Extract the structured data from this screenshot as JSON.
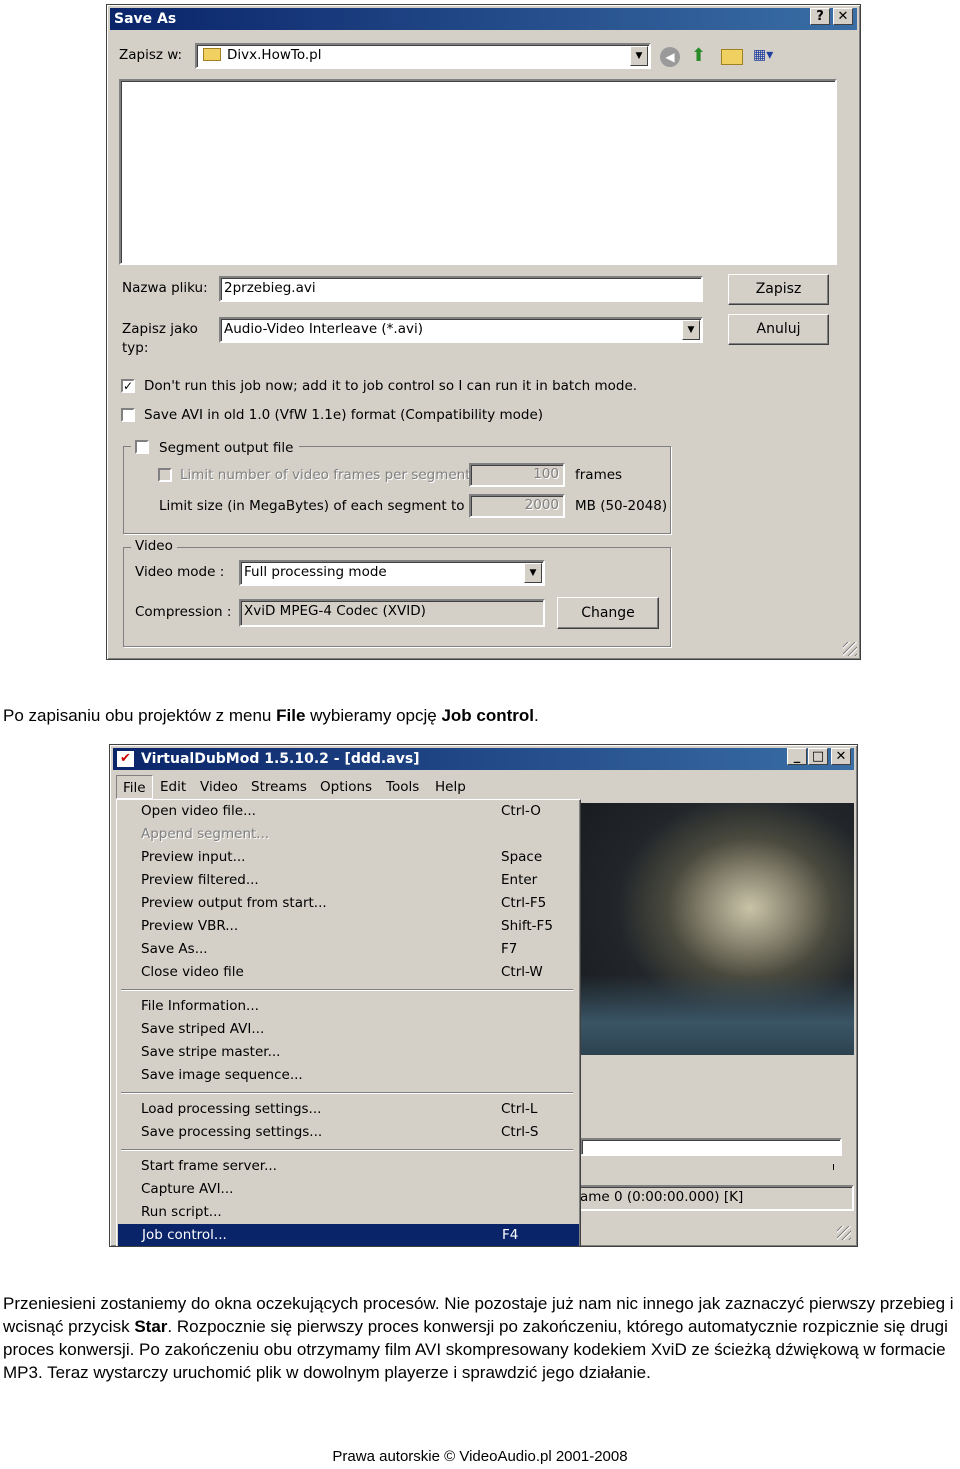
{
  "save_dialog": {
    "title": "Save As",
    "help_btn": "?",
    "close_btn": "✕",
    "location_label": "Zapisz w:",
    "location_value": "Divx.HowTo.pl",
    "filename_label": "Nazwa pliku:",
    "filename_value": "2przebieg.avi",
    "filetype_label": "Zapisz jako typ:",
    "filetype_value": "Audio-Video Interleave (*.avi)",
    "save_button": "Zapisz",
    "cancel_button": "Anuluj",
    "option_job_control": "Don't run this job now; add it to job control so I can run it in batch mode.",
    "option_old_avi": "Save AVI in old 1.0 (VfW 1.1e) format (Compatibility mode)",
    "segment_group": "Segment output file",
    "limit_frames_label": "Limit number of video frames per segment to",
    "limit_frames_value": "100",
    "frames_unit": "frames",
    "limit_size_label": "Limit size (in MegaBytes) of each segment to :",
    "limit_size_value": "2000",
    "size_unit": "MB (50-2048)",
    "video_group": "Video",
    "video_mode_label": "Video mode :",
    "video_mode_value": "Full processing mode",
    "compression_label": "Compression :",
    "compression_value": "XviD MPEG-4 Codec (XVID)",
    "change_button": "Change"
  },
  "paragraph1": {
    "t1": "Po zapisaniu obu projektów z menu ",
    "b1": "File",
    "t2": " wybieramy opcję ",
    "b2": "Job control",
    "t3": "."
  },
  "vdub": {
    "title": "VirtualDubMod 1.5.10.2 - [ddd.avs]",
    "menubar": [
      "File",
      "Edit",
      "Video",
      "Streams",
      "Options",
      "Tools",
      "Help"
    ],
    "menu_items": [
      {
        "name": "Open video file...",
        "shortcut": "Ctrl-O",
        "disabled": false
      },
      {
        "name": "Append segment...",
        "shortcut": "",
        "disabled": true
      },
      {
        "name": "Preview input...",
        "shortcut": "Space",
        "disabled": false
      },
      {
        "name": "Preview filtered...",
        "shortcut": "Enter",
        "disabled": false
      },
      {
        "name": "Preview output from start...",
        "shortcut": "Ctrl-F5",
        "disabled": false
      },
      {
        "name": "Preview VBR...",
        "shortcut": "Shift-F5",
        "disabled": false
      },
      {
        "name": "Save As...",
        "shortcut": "F7",
        "disabled": false
      },
      {
        "name": "Close video file",
        "shortcut": "Ctrl-W",
        "disabled": false
      },
      {
        "name": "File Information...",
        "shortcut": "",
        "disabled": false
      },
      {
        "name": "Save striped AVI...",
        "shortcut": "",
        "disabled": false
      },
      {
        "name": "Save stripe master...",
        "shortcut": "",
        "disabled": false
      },
      {
        "name": "Save image sequence...",
        "shortcut": "",
        "disabled": false
      },
      {
        "name": "Load processing settings...",
        "shortcut": "Ctrl-L",
        "disabled": false
      },
      {
        "name": "Save processing settings...",
        "shortcut": "Ctrl-S",
        "disabled": false
      },
      {
        "name": "Start frame server...",
        "shortcut": "",
        "disabled": false
      },
      {
        "name": "Capture AVI...",
        "shortcut": "",
        "disabled": false
      },
      {
        "name": "Run script...",
        "shortcut": "",
        "disabled": false
      },
      {
        "name": "Job control...",
        "shortcut": "F4",
        "disabled": false,
        "highlighted": true
      }
    ],
    "status_frame": "ame 0 (0:00:00.000) [K]"
  },
  "paragraph2": {
    "t1": "Przeniesieni zostaniemy do okna oczekujących procesów. Nie pozostaje już nam nic innego jak zaznaczyć pierwszy przebieg i wcisnąć przycisk ",
    "b1": "Star",
    "t2": ". Rozpocznie się pierwszy proces konwersji po zakończeniu, którego automatycznie rozpicznie się drugi proces konwersji. Po zakończeniu obu otrzymamy film AVI skompresowany kodekiem XviD ze ścieżką dźwiękową w formacie MP3. Teraz wystarczy uruchomić plik w dowolnym playerze i sprawdzić jego działanie."
  },
  "footer": "Prawa autorskie © VideoAudio.pl 2001-2008",
  "colors": {
    "titlebar": "#0a246a",
    "menu_highlight": "#0a246a",
    "dialog_bg": "#d4d0c8"
  }
}
